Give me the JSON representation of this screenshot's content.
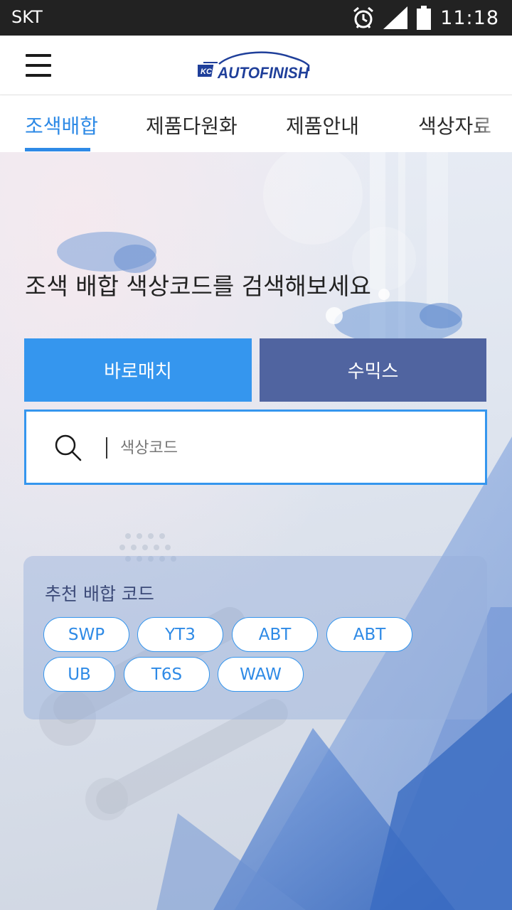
{
  "status_bar": {
    "carrier": "SKT",
    "time": "11:18",
    "icons": [
      "alarm-icon",
      "signal-icon",
      "battery-icon"
    ]
  },
  "header": {
    "logo": {
      "badge": "KCC",
      "text": "AUTOFINISH"
    },
    "menu_icon": "hamburger-menu-icon"
  },
  "tabs": [
    {
      "label": "조색배합",
      "active": true
    },
    {
      "label": "제품다원화",
      "active": false
    },
    {
      "label": "제품안내",
      "active": false
    },
    {
      "label": "색상자료",
      "active": false
    }
  ],
  "hero": {
    "headline": "조색 배합 색상코드를 검색해보세요"
  },
  "modes": {
    "baro_match": "바로매치",
    "sumix": "수믹스"
  },
  "search": {
    "placeholder": "색상코드",
    "value": "",
    "icon": "search-icon"
  },
  "recommended": {
    "title": "추천 배합 코드",
    "codes": [
      "SWP",
      "YT3",
      "ABT",
      "ABT",
      "UB",
      "T6S",
      "WAW"
    ]
  },
  "colors": {
    "accent": "#2e8ae6",
    "baro_button": "#3596ee",
    "sumix_button": "#5064a0",
    "status_bar": "#222222"
  }
}
